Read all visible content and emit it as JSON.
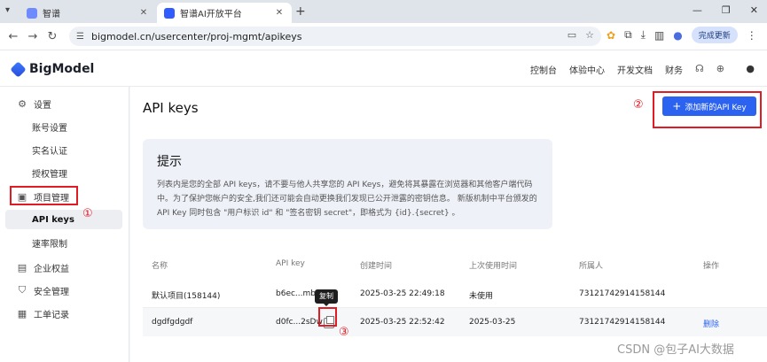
{
  "browser": {
    "tabs": [
      {
        "title": "智谱",
        "active": false
      },
      {
        "title": "智谱AI开放平台",
        "active": true
      }
    ],
    "url": "bigmodel.cn/usercenter/proj-mgmt/apikeys",
    "update_button": "完成更新"
  },
  "header": {
    "brand": "BigModel",
    "nav": [
      "控制台",
      "体验中心",
      "开发文档",
      "财务"
    ]
  },
  "sidebar": {
    "items": [
      {
        "label": "设置",
        "icon": "settings-icon",
        "type": "section"
      },
      {
        "label": "账号设置",
        "type": "sub"
      },
      {
        "label": "实名认证",
        "type": "sub"
      },
      {
        "label": "授权管理",
        "type": "sub"
      },
      {
        "label": "项目管理",
        "icon": "project-icon",
        "type": "section"
      },
      {
        "label": "API keys",
        "type": "sub",
        "selected": true
      },
      {
        "label": "速率限制",
        "type": "sub"
      },
      {
        "label": "企业权益",
        "icon": "building-icon",
        "type": "section"
      },
      {
        "label": "安全管理",
        "icon": "shield-icon",
        "type": "section"
      },
      {
        "label": "工单记录",
        "icon": "ticket-icon",
        "type": "section"
      }
    ]
  },
  "main": {
    "title": "API keys",
    "add_button": "添加新的API Key",
    "tip": {
      "title": "提示",
      "lines": [
        "列表内是您的全部 API keys，请不要与他人共享您的 API Keys，避免将其暴露在浏览器和其他客户端代码",
        "中。为了保护您帐户的安全,我们还可能会自动更换我们发现已公开泄露的密钥信息。 新版机制中平台颁发的",
        "API Key 同时包含 \"用户标识 id\" 和 \"签名密钥 secret\"，即格式为 {id}.{secret} 。"
      ]
    },
    "table": {
      "columns": [
        "名称",
        "API key",
        "创建时间",
        "上次使用时间",
        "所属人",
        "操作"
      ],
      "rows": [
        {
          "name": "默认项目(158144)",
          "key": "b6ec...mbY",
          "created": "2025-03-25 22:49:18",
          "last_used": "未使用",
          "owner": "73121742914158144",
          "action": ""
        },
        {
          "name": "dgdfgdgdf",
          "key": "d0fc...2sDw",
          "created": "2025-03-25 22:52:42",
          "last_used": "2025-03-25",
          "owner": "73121742914158144",
          "action": "删除"
        }
      ]
    },
    "copy_tooltip": "复制"
  },
  "annotations": [
    "①",
    "②",
    "③"
  ],
  "watermark": "CSDN @包子AI大数据",
  "colors": {
    "accent": "#2b63f0",
    "annotation": "#e01b24"
  }
}
